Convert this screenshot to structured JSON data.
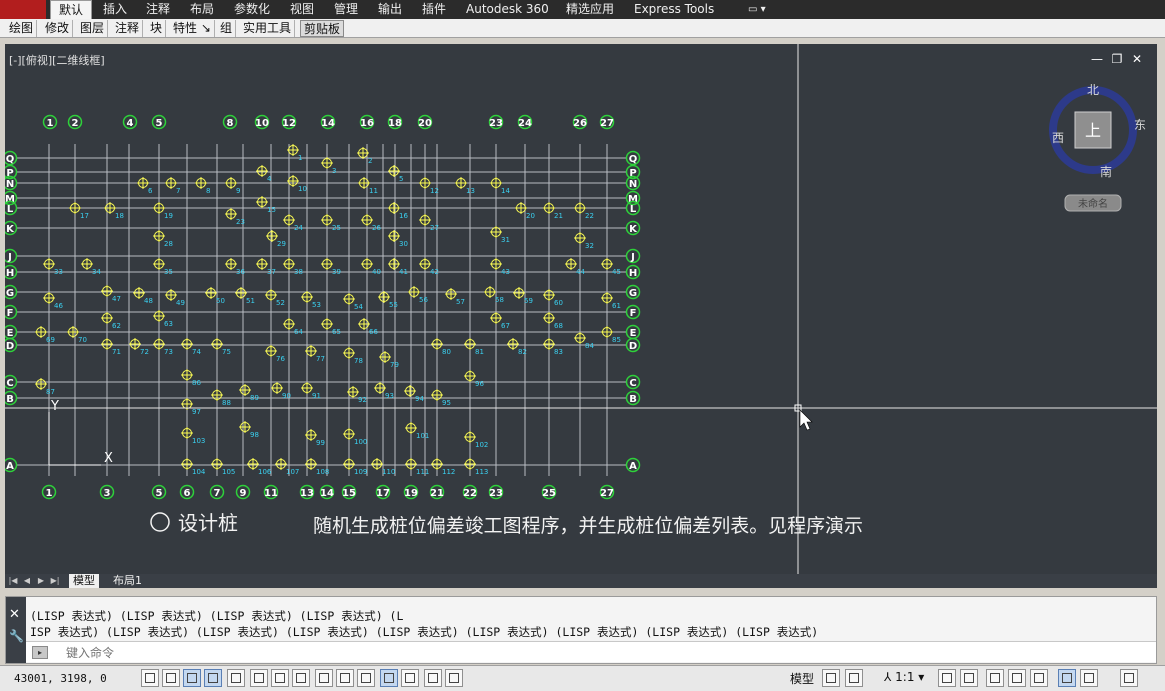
{
  "menubar": {
    "items": [
      "默认",
      "插入",
      "注释",
      "布局",
      "参数化",
      "视图",
      "管理",
      "输出",
      "插件",
      "Autodesk 360",
      "精选应用",
      "Express Tools"
    ],
    "active": "默认",
    "extra_icon": "dropdown-icon"
  },
  "panels": {
    "items": [
      "绘图",
      "修改",
      "图层",
      "注释",
      "块",
      "特性",
      "组",
      "实用工具",
      "剪贴板"
    ],
    "selected": "剪贴板"
  },
  "viewport": {
    "label": "[-][俯视][二维线框]",
    "window_controls": [
      "minimize-icon",
      "restore-icon",
      "close-icon"
    ]
  },
  "viewcube": {
    "north": "北",
    "south": "南",
    "east": "东",
    "west": "西",
    "face": "上",
    "wcs": "未命名"
  },
  "ucs": {
    "y_label": "Y",
    "x_label": "X"
  },
  "grid": {
    "top_axes": [
      "1",
      "2",
      "4",
      "5",
      "8",
      "10",
      "12",
      "14",
      "16",
      "18",
      "20",
      "23",
      "24",
      "26",
      "27"
    ],
    "bottom_axes": [
      "1",
      "3",
      "5",
      "6",
      "7",
      "9",
      "11",
      "13",
      "14",
      "15",
      "17",
      "19",
      "21",
      "22",
      "23",
      "25",
      "27"
    ],
    "left_axes": [
      "Q",
      "P",
      "N",
      "M",
      "L",
      "K",
      "J",
      "H",
      "G",
      "F",
      "E",
      "D",
      "C",
      "B",
      "A"
    ],
    "right_axes": [
      "Q",
      "P",
      "N",
      "M",
      "L",
      "K",
      "J",
      "H",
      "G",
      "F",
      "E",
      "D",
      "C",
      "B",
      "A"
    ]
  },
  "annotations": {
    "legend_text": "设计桩",
    "description": "随机生成桩位偏差竣工图程序，并生成桩位偏差列表。见程序演示"
  },
  "layout_tabs": {
    "model": "模型",
    "layout1": "布局1"
  },
  "command": {
    "line1": "(LISP 表达式) (LISP 表达式) (LISP 表达式) (LISP 表达式) (L",
    "line2": "ISP 表达式) (LISP 表达式) (LISP 表达式) (LISP 表达式) (LISP 表达式) (LISP 表达式) (LISP 表达式) (LISP 表达式) (LISP 表达式)",
    "placeholder": "键入命令"
  },
  "status": {
    "coords": "43001, 3198, 0",
    "model_label": "模型",
    "scale": "1:1"
  },
  "colors": {
    "canvas_bg": "#353a40",
    "grid_line": "#b9bcc2",
    "axis_bubble": "#2ed13a",
    "pile": "#ffff55",
    "pile_label": "#3ad0f0",
    "annotation_text": "#f2f2f2",
    "viewcube_ring": "#2d3a8a"
  }
}
